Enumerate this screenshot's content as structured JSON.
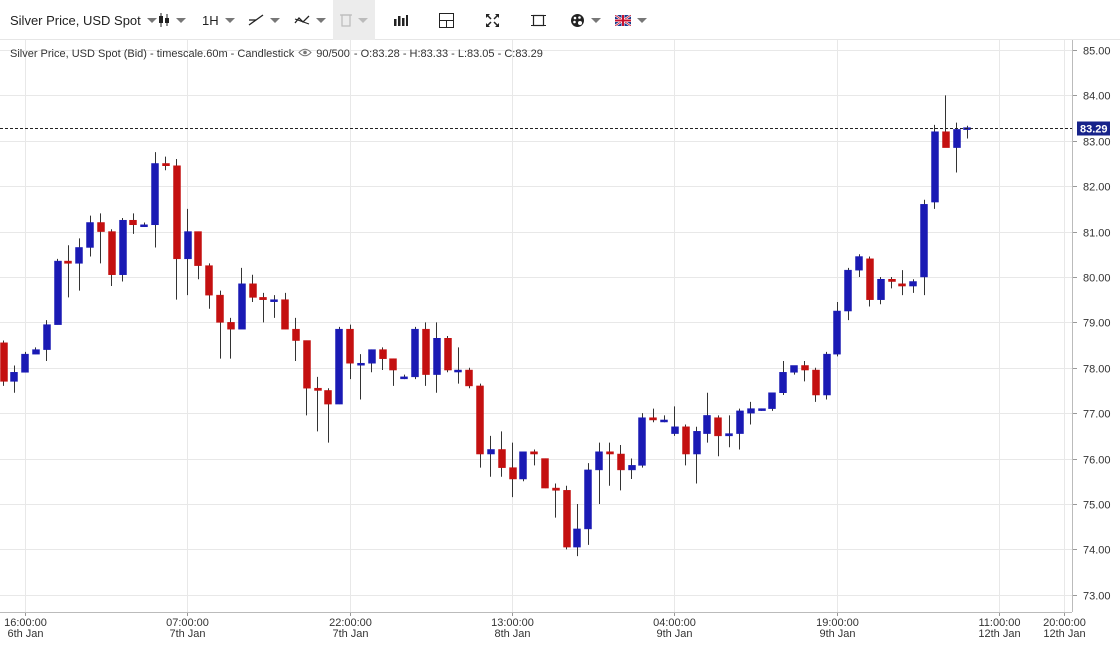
{
  "toolbar": {
    "instrument": "Silver Price, USD Spot",
    "timeframe": "1H"
  },
  "info": {
    "title": "Silver Price, USD Spot (Bid) - timescale.60m - Candlestick",
    "count": "90/500",
    "ohlc": "- O:83.28 - H:83.33 - L:83.05 - C:83.29"
  },
  "colors": {
    "up": "#1a1ab4",
    "down": "#c41010",
    "grid": "#e8e8e8",
    "current_price_bg": "#17238a"
  },
  "chart_data": {
    "type": "candlestick",
    "y_ticks": [
      "85.00",
      "84.00",
      "83.00",
      "82.00",
      "81.00",
      "80.00",
      "79.00",
      "78.00",
      "77.00",
      "76.00",
      "75.00",
      "74.00",
      "73.00"
    ],
    "ylim": [
      72.62,
      85.22
    ],
    "current_price": 83.29,
    "current_price_label": "83.29",
    "x_labels": [
      {
        "index": 2,
        "time": "16:00:00",
        "date": "6th Jan"
      },
      {
        "index": 17,
        "time": "07:00:00",
        "date": "7th Jan"
      },
      {
        "index": 32,
        "time": "22:00:00",
        "date": "7th Jan"
      },
      {
        "index": 47,
        "time": "13:00:00",
        "date": "8th Jan"
      },
      {
        "index": 62,
        "time": "04:00:00",
        "date": "9th Jan"
      },
      {
        "index": 77,
        "time": "19:00:00",
        "date": "9th Jan"
      },
      {
        "index": 92,
        "time": "11:00:00",
        "date": "12th Jan"
      },
      {
        "index": 98,
        "time": "20:00:00",
        "date": "12th Jan"
      }
    ],
    "candles": [
      {
        "i": 0,
        "o": 78.55,
        "h": 78.6,
        "l": 77.6,
        "c": 77.7
      },
      {
        "i": 1,
        "o": 77.7,
        "h": 78.05,
        "l": 77.45,
        "c": 77.9
      },
      {
        "i": 2,
        "o": 77.9,
        "h": 78.35,
        "l": 77.9,
        "c": 78.3
      },
      {
        "i": 3,
        "o": 78.3,
        "h": 78.45,
        "l": 78.3,
        "c": 78.4
      },
      {
        "i": 4,
        "o": 78.4,
        "h": 79.05,
        "l": 78.15,
        "c": 78.95
      },
      {
        "i": 5,
        "o": 78.95,
        "h": 80.4,
        "l": 78.95,
        "c": 80.35
      },
      {
        "i": 6,
        "o": 80.35,
        "h": 80.7,
        "l": 79.55,
        "c": 80.3
      },
      {
        "i": 7,
        "o": 80.3,
        "h": 80.85,
        "l": 79.7,
        "c": 80.65
      },
      {
        "i": 8,
        "o": 80.65,
        "h": 81.35,
        "l": 80.45,
        "c": 81.2
      },
      {
        "i": 9,
        "o": 81.2,
        "h": 81.4,
        "l": 80.3,
        "c": 81.0
      },
      {
        "i": 10,
        "o": 81.0,
        "h": 81.05,
        "l": 79.8,
        "c": 80.05
      },
      {
        "i": 11,
        "o": 80.05,
        "h": 81.3,
        "l": 79.9,
        "c": 81.25
      },
      {
        "i": 12,
        "o": 81.25,
        "h": 81.4,
        "l": 80.95,
        "c": 81.15
      },
      {
        "i": 13,
        "o": 81.15,
        "h": 81.2,
        "l": 81.1,
        "c": 81.15
      },
      {
        "i": 14,
        "o": 81.15,
        "h": 82.75,
        "l": 80.65,
        "c": 82.5
      },
      {
        "i": 15,
        "o": 82.5,
        "h": 82.65,
        "l": 82.35,
        "c": 82.45
      },
      {
        "i": 16,
        "o": 82.45,
        "h": 82.6,
        "l": 79.5,
        "c": 80.4
      },
      {
        "i": 17,
        "o": 80.4,
        "h": 81.5,
        "l": 79.6,
        "c": 81.0
      },
      {
        "i": 18,
        "o": 81.0,
        "h": 81.0,
        "l": 79.95,
        "c": 80.25
      },
      {
        "i": 19,
        "o": 80.25,
        "h": 80.3,
        "l": 79.3,
        "c": 79.6
      },
      {
        "i": 20,
        "o": 79.6,
        "h": 79.7,
        "l": 78.2,
        "c": 79.0
      },
      {
        "i": 21,
        "o": 79.0,
        "h": 79.1,
        "l": 78.2,
        "c": 78.85
      },
      {
        "i": 22,
        "o": 78.85,
        "h": 80.2,
        "l": 78.9,
        "c": 79.85
      },
      {
        "i": 23,
        "o": 79.85,
        "h": 80.05,
        "l": 79.45,
        "c": 79.55
      },
      {
        "i": 24,
        "o": 79.55,
        "h": 79.65,
        "l": 79.0,
        "c": 79.5
      },
      {
        "i": 25,
        "o": 79.5,
        "h": 79.6,
        "l": 79.1,
        "c": 79.5
      },
      {
        "i": 26,
        "o": 79.5,
        "h": 79.65,
        "l": 78.85,
        "c": 78.85
      },
      {
        "i": 27,
        "o": 78.85,
        "h": 79.1,
        "l": 78.15,
        "c": 78.6
      },
      {
        "i": 28,
        "o": 78.6,
        "h": 78.6,
        "l": 76.95,
        "c": 77.55
      },
      {
        "i": 29,
        "o": 77.55,
        "h": 77.8,
        "l": 76.6,
        "c": 77.5
      },
      {
        "i": 30,
        "o": 77.5,
        "h": 77.55,
        "l": 76.35,
        "c": 77.2
      },
      {
        "i": 31,
        "o": 77.2,
        "h": 78.9,
        "l": 77.2,
        "c": 78.85
      },
      {
        "i": 32,
        "o": 78.85,
        "h": 78.95,
        "l": 77.75,
        "c": 78.1
      },
      {
        "i": 33,
        "o": 78.1,
        "h": 78.3,
        "l": 77.3,
        "c": 78.1
      },
      {
        "i": 34,
        "o": 78.1,
        "h": 78.4,
        "l": 77.9,
        "c": 78.4
      },
      {
        "i": 35,
        "o": 78.4,
        "h": 78.45,
        "l": 77.95,
        "c": 78.2
      },
      {
        "i": 36,
        "o": 78.2,
        "h": 78.2,
        "l": 77.6,
        "c": 77.95
      },
      {
        "i": 37,
        "o": 77.8,
        "h": 77.85,
        "l": 77.75,
        "c": 77.8
      },
      {
        "i": 38,
        "o": 77.8,
        "h": 78.9,
        "l": 77.75,
        "c": 78.85
      },
      {
        "i": 39,
        "o": 78.85,
        "h": 79.0,
        "l": 77.6,
        "c": 77.85
      },
      {
        "i": 40,
        "o": 77.85,
        "h": 79.0,
        "l": 77.45,
        "c": 78.65
      },
      {
        "i": 41,
        "o": 78.65,
        "h": 78.7,
        "l": 77.9,
        "c": 77.95
      },
      {
        "i": 42,
        "o": 77.95,
        "h": 78.45,
        "l": 77.65,
        "c": 77.95
      },
      {
        "i": 43,
        "o": 77.95,
        "h": 78.0,
        "l": 77.55,
        "c": 77.6
      },
      {
        "i": 44,
        "o": 77.6,
        "h": 77.65,
        "l": 75.8,
        "c": 76.1
      },
      {
        "i": 45,
        "o": 76.1,
        "h": 76.5,
        "l": 75.6,
        "c": 76.2
      },
      {
        "i": 46,
        "o": 76.2,
        "h": 76.6,
        "l": 75.6,
        "c": 75.8
      },
      {
        "i": 47,
        "o": 75.8,
        "h": 76.35,
        "l": 75.15,
        "c": 75.55
      },
      {
        "i": 48,
        "o": 75.55,
        "h": 76.15,
        "l": 75.5,
        "c": 76.15
      },
      {
        "i": 49,
        "o": 76.15,
        "h": 76.2,
        "l": 75.85,
        "c": 76.1
      },
      {
        "i": 50,
        "o": 76.0,
        "h": 76.0,
        "l": 75.35,
        "c": 75.35
      },
      {
        "i": 51,
        "o": 75.35,
        "h": 75.45,
        "l": 74.7,
        "c": 75.3
      },
      {
        "i": 52,
        "o": 75.3,
        "h": 75.4,
        "l": 74.0,
        "c": 74.05
      },
      {
        "i": 53,
        "o": 74.05,
        "h": 75.0,
        "l": 73.85,
        "c": 74.45
      },
      {
        "i": 54,
        "o": 74.45,
        "h": 75.9,
        "l": 74.1,
        "c": 75.75
      },
      {
        "i": 55,
        "o": 75.75,
        "h": 76.35,
        "l": 75.0,
        "c": 76.15
      },
      {
        "i": 56,
        "o": 76.15,
        "h": 76.35,
        "l": 75.4,
        "c": 76.1
      },
      {
        "i": 57,
        "o": 76.1,
        "h": 76.3,
        "l": 75.3,
        "c": 75.75
      },
      {
        "i": 58,
        "o": 75.75,
        "h": 76.0,
        "l": 75.55,
        "c": 75.85
      },
      {
        "i": 59,
        "o": 75.85,
        "h": 77.0,
        "l": 75.8,
        "c": 76.9
      },
      {
        "i": 60,
        "o": 76.9,
        "h": 77.1,
        "l": 76.8,
        "c": 76.85
      },
      {
        "i": 61,
        "o": 76.85,
        "h": 76.95,
        "l": 76.8,
        "c": 76.85
      },
      {
        "i": 62,
        "o": 76.55,
        "h": 77.15,
        "l": 76.5,
        "c": 76.7
      },
      {
        "i": 63,
        "o": 76.7,
        "h": 76.75,
        "l": 75.85,
        "c": 76.1
      },
      {
        "i": 64,
        "o": 76.1,
        "h": 76.7,
        "l": 75.45,
        "c": 76.6
      },
      {
        "i": 65,
        "o": 76.55,
        "h": 77.45,
        "l": 76.35,
        "c": 76.95
      },
      {
        "i": 66,
        "o": 76.9,
        "h": 76.95,
        "l": 76.05,
        "c": 76.5
      },
      {
        "i": 67,
        "o": 76.5,
        "h": 76.95,
        "l": 76.25,
        "c": 76.55
      },
      {
        "i": 68,
        "o": 76.55,
        "h": 77.1,
        "l": 76.2,
        "c": 77.05
      },
      {
        "i": 69,
        "o": 77.0,
        "h": 77.25,
        "l": 76.75,
        "c": 77.1
      },
      {
        "i": 70,
        "o": 77.1,
        "h": 77.1,
        "l": 77.05,
        "c": 77.1
      },
      {
        "i": 71,
        "o": 77.1,
        "h": 77.45,
        "l": 77.05,
        "c": 77.45
      },
      {
        "i": 72,
        "o": 77.45,
        "h": 78.15,
        "l": 77.4,
        "c": 77.9
      },
      {
        "i": 73,
        "o": 77.9,
        "h": 78.05,
        "l": 77.85,
        "c": 78.05
      },
      {
        "i": 74,
        "o": 78.05,
        "h": 78.15,
        "l": 77.7,
        "c": 77.95
      },
      {
        "i": 75,
        "o": 77.95,
        "h": 78.0,
        "l": 77.25,
        "c": 77.4
      },
      {
        "i": 76,
        "o": 77.4,
        "h": 78.35,
        "l": 77.3,
        "c": 78.3
      },
      {
        "i": 77,
        "o": 78.3,
        "h": 79.45,
        "l": 78.25,
        "c": 79.25
      },
      {
        "i": 78,
        "o": 79.25,
        "h": 80.2,
        "l": 79.05,
        "c": 80.15
      },
      {
        "i": 79,
        "o": 80.15,
        "h": 80.5,
        "l": 80.0,
        "c": 80.45
      },
      {
        "i": 80,
        "o": 80.4,
        "h": 80.45,
        "l": 79.35,
        "c": 79.5
      },
      {
        "i": 81,
        "o": 79.5,
        "h": 80.0,
        "l": 79.4,
        "c": 79.95
      },
      {
        "i": 82,
        "o": 79.95,
        "h": 80.0,
        "l": 79.75,
        "c": 79.9
      },
      {
        "i": 83,
        "o": 79.85,
        "h": 80.15,
        "l": 79.6,
        "c": 79.8
      },
      {
        "i": 84,
        "o": 79.8,
        "h": 79.95,
        "l": 79.65,
        "c": 79.9
      },
      {
        "i": 85,
        "o": 80.0,
        "h": 81.7,
        "l": 79.6,
        "c": 81.6
      },
      {
        "i": 86,
        "o": 81.65,
        "h": 83.35,
        "l": 81.5,
        "c": 83.2
      },
      {
        "i": 87,
        "o": 83.2,
        "h": 84.0,
        "l": 82.9,
        "c": 82.85
      },
      {
        "i": 88,
        "o": 82.85,
        "h": 83.4,
        "l": 82.3,
        "c": 83.25
      },
      {
        "i": 89,
        "o": 83.28,
        "h": 83.33,
        "l": 83.05,
        "c": 83.29
      }
    ]
  }
}
